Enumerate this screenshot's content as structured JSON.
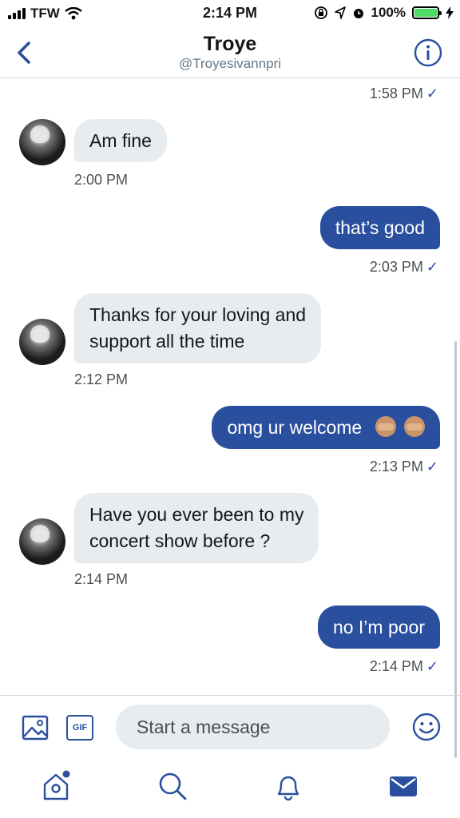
{
  "status_bar": {
    "carrier": "TFW",
    "time": "2:14 PM",
    "battery": "100%"
  },
  "header": {
    "title": "Troye",
    "handle": "@Troyesivannpri"
  },
  "messages": [
    {
      "direction": "out",
      "text": "",
      "time": "1:58 PM"
    },
    {
      "direction": "in",
      "text": "Am fine",
      "time": "2:00 PM"
    },
    {
      "direction": "out",
      "text": "that’s good",
      "time": "2:03 PM"
    },
    {
      "direction": "in",
      "lines": [
        "Thanks for your loving and",
        "support all the time"
      ],
      "time": "2:12 PM"
    },
    {
      "direction": "out",
      "text": "omg ur welcome",
      "emoji": "see-no-evil-monkey x2",
      "time": "2:13 PM"
    },
    {
      "direction": "in",
      "lines": [
        "Have you ever been to my",
        "concert show before ?"
      ],
      "time": "2:14 PM"
    },
    {
      "direction": "out",
      "text": "no I’m poor",
      "time": "2:14 PM"
    }
  ],
  "composer": {
    "gif_label": "GIF",
    "placeholder": "Start a message"
  },
  "colors": {
    "accent": "#2a4f9e",
    "incoming_bubble": "#e6ecf0",
    "battery": "#4cd964",
    "notification_dot": "#2a4f9e"
  },
  "tabbar": {
    "items": [
      "home-icon",
      "search-icon",
      "notifications-icon",
      "messages-icon"
    ],
    "active": "messages-icon"
  }
}
